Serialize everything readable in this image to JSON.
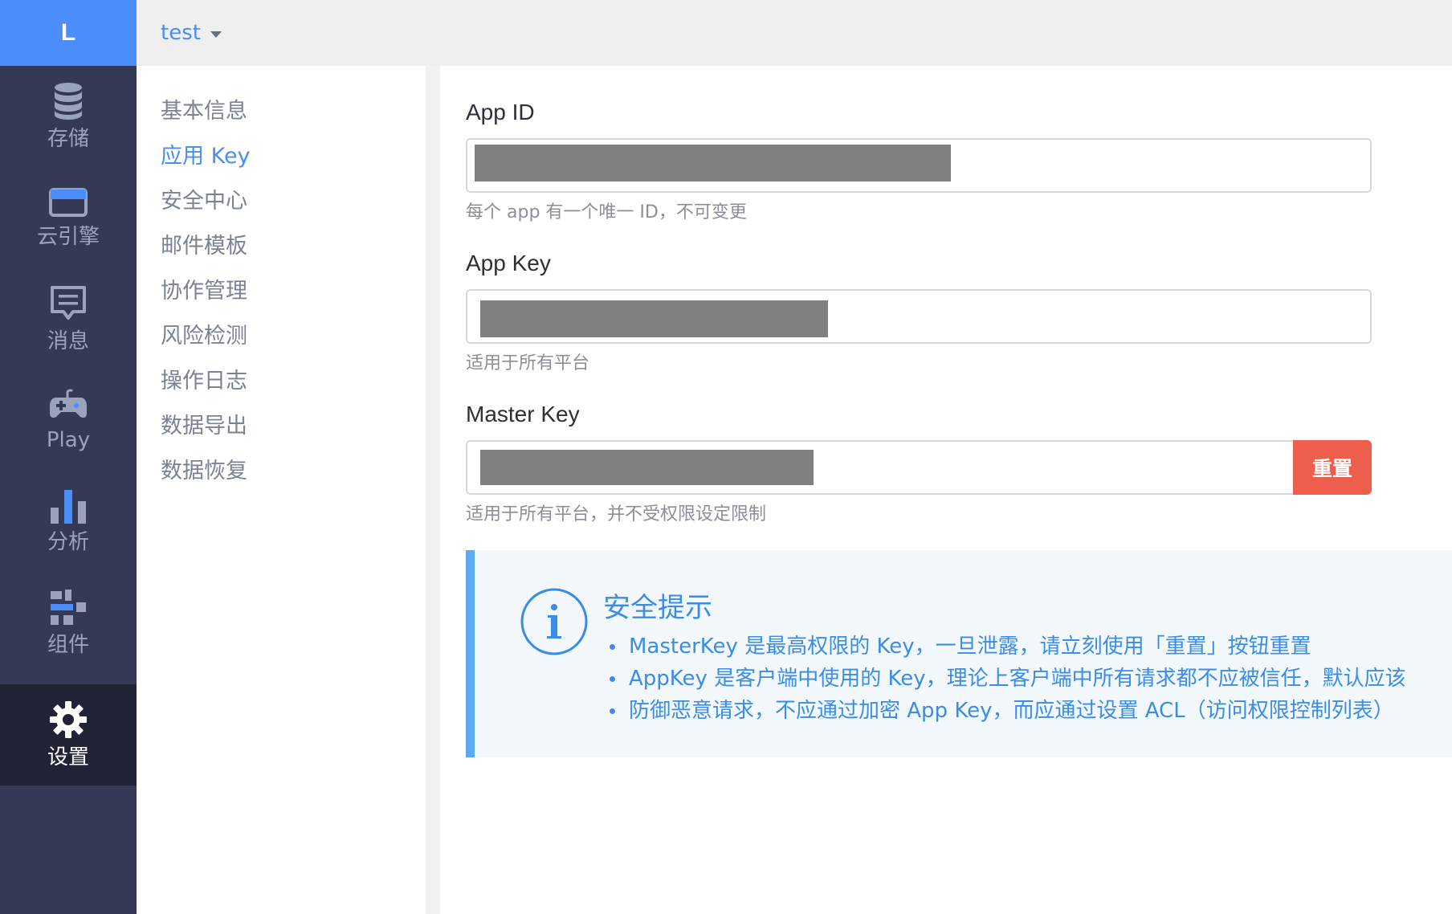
{
  "rail": {
    "logo": "L",
    "items": [
      {
        "label": "存储",
        "icon": "database-icon"
      },
      {
        "label": "云引擎",
        "icon": "server-icon"
      },
      {
        "label": "消息",
        "icon": "message-icon"
      },
      {
        "label": "Play",
        "icon": "gamepad-icon"
      },
      {
        "label": "分析",
        "icon": "bar-chart-icon"
      },
      {
        "label": "组件",
        "icon": "components-icon"
      },
      {
        "label": "设置",
        "icon": "gear-icon",
        "active": true
      }
    ]
  },
  "topbar": {
    "app_name": "test"
  },
  "subnav": {
    "items": [
      {
        "label": "基本信息"
      },
      {
        "label": "应用 Key",
        "active": true
      },
      {
        "label": "安全中心"
      },
      {
        "label": "邮件模板"
      },
      {
        "label": "协作管理"
      },
      {
        "label": "风险检测"
      },
      {
        "label": "操作日志"
      },
      {
        "label": "数据导出"
      },
      {
        "label": "数据恢复"
      }
    ]
  },
  "fields": {
    "app_id": {
      "label": "App ID",
      "help": "每个 app 有一个唯一 ID，不可变更"
    },
    "app_key": {
      "label": "App Key",
      "help": "适用于所有平台"
    },
    "master_key": {
      "label": "Master Key",
      "help": "适用于所有平台，并不受权限设定限制",
      "button": "重置"
    }
  },
  "tip": {
    "icon": "info-icon",
    "title": "安全提示",
    "items": [
      "MasterKey 是最高权限的 Key，一旦泄露，请立刻使用「重置」按钮重置",
      "AppKey 是客户端中使用的 Key，理论上客户端中所有请求都不应被信任，默认应该",
      "防御恶意请求，不应通过加密 App Key，而应通过设置 ACL（访问权限控制列表）"
    ]
  },
  "colors": {
    "rail_bg": "#343a55",
    "rail_active_bg": "#1f2335",
    "logo_bg": "#4b8ef7",
    "accent": "#4a8ef0",
    "danger": "#ee5e4d",
    "tip_border": "#5aabf0"
  }
}
